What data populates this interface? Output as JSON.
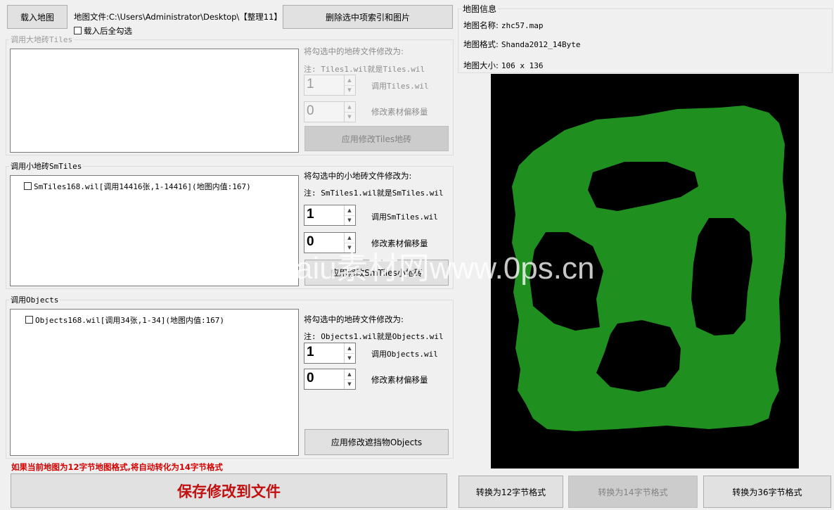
{
  "toolbar": {
    "load_map": "载入地图",
    "map_file_label": "地图文件:C:\\Users\\Administrator\\Desktop\\【整理11】",
    "delete_selected": "删除选中项索引和图片",
    "select_all_after_load": "载入后全勾选"
  },
  "tiles_group": {
    "title": "调用大地砖Tiles",
    "change_to": "将勾选中的地砖文件修改为:",
    "note": "注: Tiles1.wil就是Tiles.wil",
    "index_value": "1",
    "index_label": "调用Tiles.wil",
    "offset_value": "0",
    "offset_label": "修改素材偏移量",
    "apply": "应用修改Tiles地砖"
  },
  "smtiles_group": {
    "title": "调用小地砖SmTiles",
    "items": [
      "SmTiles168.wil[调用14416张,1-14416](地图内值:167)"
    ],
    "change_to": "将勾选中的小地砖文件修改为:",
    "note": "注: SmTiles1.wil就是SmTiles.wil",
    "index_value": "1",
    "index_label": "调用SmTiles.wil",
    "offset_value": "0",
    "offset_label": "修改素材偏移量",
    "apply": "应用修改SmTiles小地砖"
  },
  "objects_group": {
    "title": "调用Objects",
    "items": [
      "Objects168.wil[调用34张,1-34](地图内值:167)"
    ],
    "change_to": "将勾选中的地砖文件修改为:",
    "note": "注: Objects1.wil就是Objects.wil",
    "index_value": "1",
    "index_label": "调用Objects.wil",
    "offset_value": "0",
    "offset_label": "修改素材偏移量",
    "apply": "应用修改遮挡物Objects"
  },
  "warning": "如果当前地图为12字节地图格式,将自动转化为14字节格式",
  "save_button": "保存修改到文件",
  "map_info": {
    "title": "地图信息",
    "name_label": "地图名称:",
    "name_value": "zhc57.map",
    "format_label": "地图格式:",
    "format_value": "Shanda2012_14Byte",
    "size_label": "地图大小:",
    "size_value": "106 x 136"
  },
  "convert": {
    "to12": "转换为12字节格式",
    "to14": "转换为14字节格式",
    "to36": "转换为36字节格式"
  },
  "watermark": "aiu素材网www.0ps.cn",
  "colors": {
    "map_bg": "#000000",
    "map_walkable": "#1f8f1f",
    "warning_red": "#d40000",
    "save_red": "#c01010"
  }
}
